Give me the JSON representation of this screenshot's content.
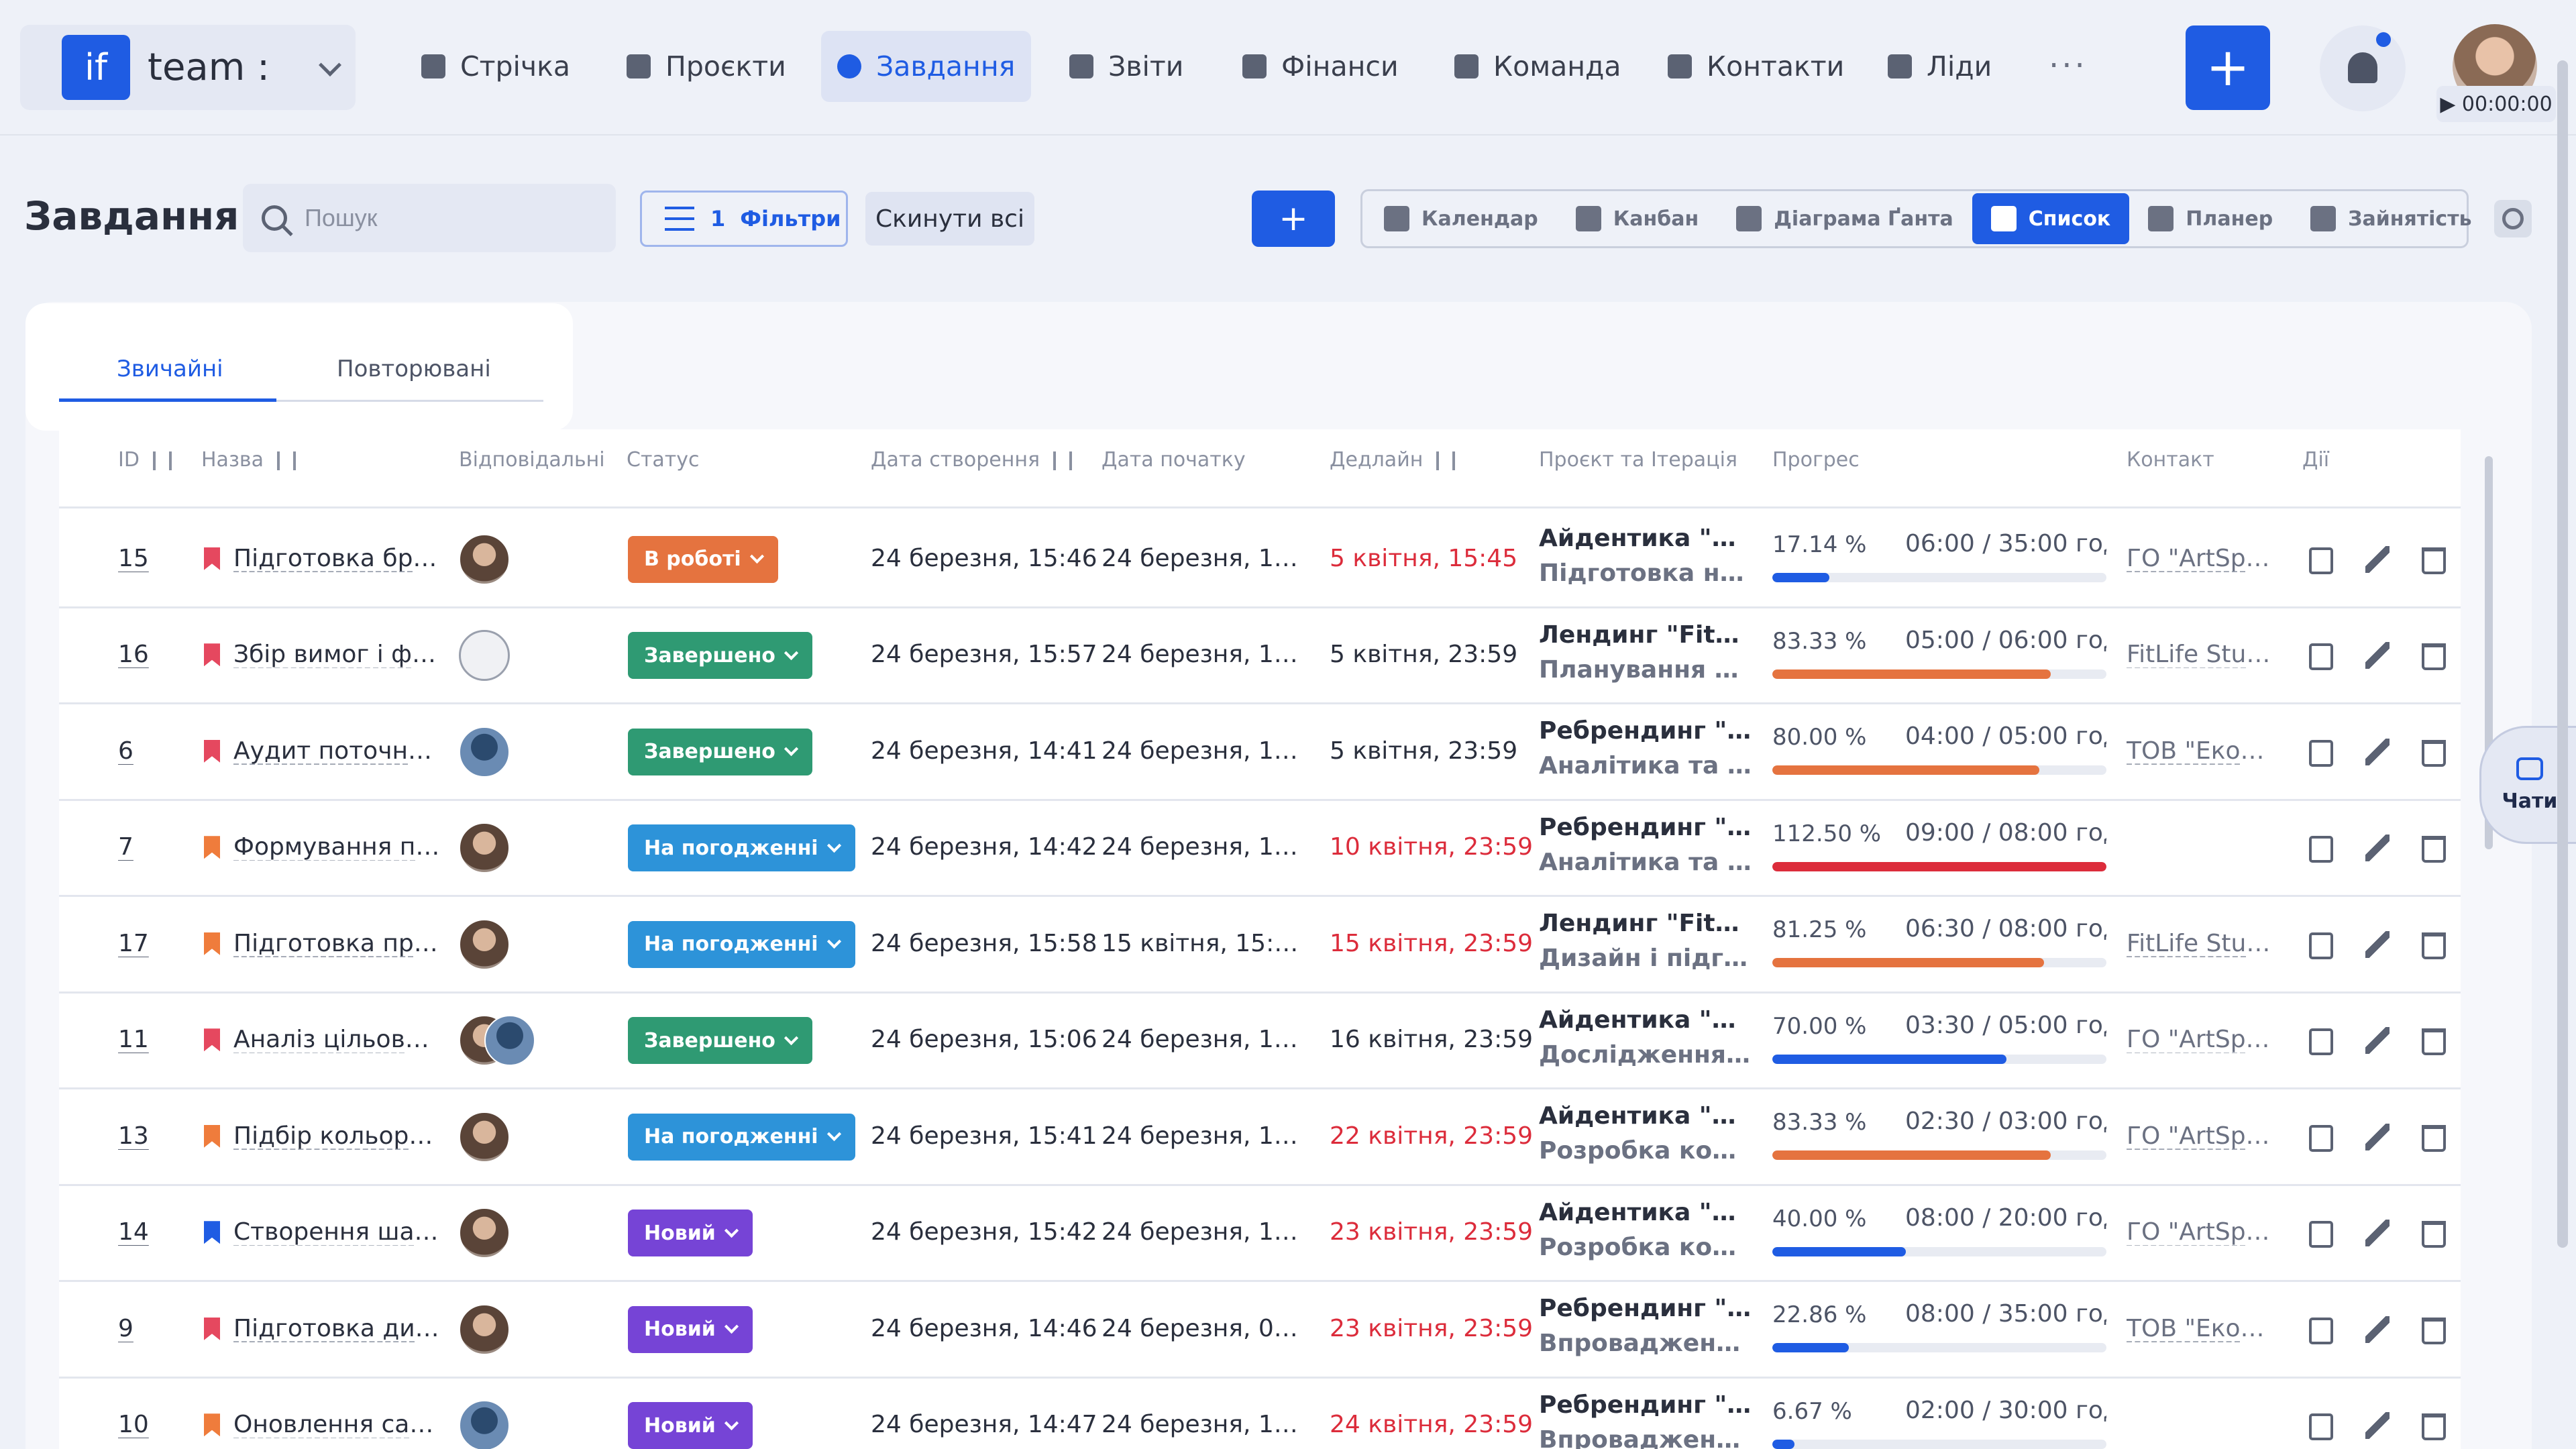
{
  "app": {
    "logo_text": "if",
    "workspace": "team :",
    "timer": "▶ 00:00:00"
  },
  "nav": [
    {
      "label": "Стрічка",
      "icon": "home-icon"
    },
    {
      "label": "Проєкти",
      "icon": "document-icon"
    },
    {
      "label": "Завдання",
      "icon": "check-circle-icon",
      "active": true
    },
    {
      "label": "Звіти",
      "icon": "report-icon"
    },
    {
      "label": "Фінанси",
      "icon": "wallet-icon"
    },
    {
      "label": "Команда",
      "icon": "user-icon"
    },
    {
      "label": "Контакти",
      "icon": "contacts-icon"
    },
    {
      "label": "Ліди",
      "icon": "leads-icon"
    }
  ],
  "more_label": "···",
  "plus_label": "+",
  "page": {
    "title": "Завдання",
    "search_placeholder": "Пошук",
    "filters_count": "1",
    "filters_label": "Фільтри",
    "reset_label": "Скинути всі",
    "add_label": "+"
  },
  "views": [
    {
      "label": "Календар",
      "icon": "calendar-icon"
    },
    {
      "label": "Канбан",
      "icon": "kanban-icon"
    },
    {
      "label": "Діаграма Ґанта",
      "icon": "gantt-icon"
    },
    {
      "label": "Список",
      "icon": "list-icon",
      "active": true
    },
    {
      "label": "Планер",
      "icon": "planner-icon"
    },
    {
      "label": "Зайнятість",
      "icon": "clock-icon"
    }
  ],
  "tabs": {
    "regular": "Звичайні",
    "recurring": "Повторювані"
  },
  "columns": {
    "id": "ID",
    "name": "Назва",
    "assignees": "Відповідальні",
    "status": "Статус",
    "created": "Дата створення",
    "start": "Дата початку",
    "deadline": "Дедлайн",
    "project": "Проєкт та Ітерація",
    "progress": "Прогрес",
    "contact": "Контакт",
    "actions": "Дії"
  },
  "colors": {
    "accent": "#1f5ce3",
    "overdue": "#dc2c3b",
    "flag_red": "#e5485f",
    "flag_orange": "#ef7c3c",
    "flag_blue": "#1f5ce3"
  },
  "status_colors": {
    "В роботі": "#e5733f",
    "Завершено": "#2f9a73",
    "На погодженні": "#2d93d9",
    "Новий": "#7644d6"
  },
  "rows": [
    {
      "id": "15",
      "flag": "#e5485f",
      "name": "Підготовка брен…",
      "assignees": 1,
      "status": "В роботі",
      "created": "24 березня, 15:46",
      "start": "24 березня, 15:45",
      "deadline": "5 квітня, 15:45",
      "overdue": true,
      "project": "Айдентика \"ArtS…",
      "iteration": "Підготовка носії…",
      "pct": "17.14 %",
      "hours": "06:00 / 35:00 год",
      "progress": 0.1714,
      "bar": "#1f5ce3",
      "contact": "ГО \"ArtSpac…"
    },
    {
      "id": "16",
      "flag": "#e5485f",
      "name": "Збір вимог і фор…",
      "assignees": 1,
      "status": "Завершено",
      "created": "24 березня, 15:57",
      "start": "24 березня, 15:56",
      "deadline": "5 квітня, 23:59",
      "overdue": false,
      "project": "Лендинг \"FitLife\"",
      "iteration": "Планування та с…",
      "pct": "83.33 %",
      "hours": "05:00 / 06:00 год",
      "progress": 0.8333,
      "bar": "#e5733f",
      "contact": "FitLife Studio"
    },
    {
      "id": "6",
      "flag": "#e5485f",
      "name": "Аудит поточного…",
      "assignees": 1,
      "status": "Завершено",
      "created": "24 березня, 14:41",
      "start": "24 березня, 14:40",
      "deadline": "5 квітня, 23:59",
      "overdue": false,
      "project": "Ребрендинг \"Еко…",
      "iteration": "Аналітика та бре…",
      "pct": "80.00 %",
      "hours": "04:00 / 05:00 год",
      "progress": 0.8,
      "bar": "#e5733f",
      "contact": "ТОВ \"ЕкоФу…"
    },
    {
      "id": "7",
      "flag": "#ef7c3c",
      "name": "Формування поз…",
      "assignees": 1,
      "status": "На погодженні",
      "created": "24 березня, 14:42",
      "start": "24 березня, 14:42",
      "deadline": "10 квітня, 23:59",
      "overdue": true,
      "project": "Ребрендинг \"Еко…",
      "iteration": "Аналітика та бре…",
      "pct": "112.50 %",
      "hours": "09:00 / 08:00 год",
      "progress": 1.0,
      "bar": "#dc2c3b",
      "contact": ""
    },
    {
      "id": "17",
      "flag": "#ef7c3c",
      "name": "Підготовка прот…",
      "assignees": 1,
      "status": "На погодженні",
      "created": "24 березня, 15:58",
      "start": "15 квітня, 15:57",
      "deadline": "15 квітня, 23:59",
      "overdue": true,
      "project": "Лендинг \"FitLife\"",
      "iteration": "Дизайн і підгото…",
      "pct": "81.25 %",
      "hours": "06:30 / 08:00 год",
      "progress": 0.8125,
      "bar": "#e5733f",
      "contact": "FitLife Studio"
    },
    {
      "id": "11",
      "flag": "#e5485f",
      "name": "Аналіз цільової а…",
      "assignees": 2,
      "status": "Завершено",
      "created": "24 березня, 15:06",
      "start": "24 березня, 15:05",
      "deadline": "16 квітня, 23:59",
      "overdue": false,
      "project": "Айдентика \"ArtS…",
      "iteration": "Дослідження бр…",
      "pct": "70.00 %",
      "hours": "03:30 / 05:00 год",
      "progress": 0.7,
      "bar": "#1f5ce3",
      "contact": "ГО \"ArtSpac…"
    },
    {
      "id": "13",
      "flag": "#ef7c3c",
      "name": "Підбір кольоров…",
      "assignees": 1,
      "status": "На погодженні",
      "created": "24 березня, 15:41",
      "start": "24 березня, 15:40",
      "deadline": "22 квітня, 23:59",
      "overdue": true,
      "project": "Айдентика \"ArtS…",
      "iteration": "Розробка конце…",
      "pct": "83.33 %",
      "hours": "02:30 / 03:00 год",
      "progress": 0.8333,
      "bar": "#e5733f",
      "contact": "ГО \"ArtSpac…"
    },
    {
      "id": "14",
      "flag": "#1f5ce3",
      "name": "Створення шабл…",
      "assignees": 1,
      "status": "Новий",
      "created": "24 березня, 15:42",
      "start": "24 березня, 15:42",
      "deadline": "23 квітня, 23:59",
      "overdue": true,
      "project": "Айдентика \"ArtS…",
      "iteration": "Розробка конце…",
      "pct": "40.00 %",
      "hours": "08:00 / 20:00 год",
      "progress": 0.4,
      "bar": "#1f5ce3",
      "contact": "ГО \"ArtSpac…"
    },
    {
      "id": "9",
      "flag": "#e5485f",
      "name": "Підготовка диза…",
      "assignees": 1,
      "status": "Новий",
      "created": "24 березня, 14:46",
      "start": "24 березня, 08:…",
      "deadline": "23 квітня, 23:59",
      "overdue": true,
      "project": "Ребрендинг \"Еко…",
      "iteration": "Впровадження т…",
      "pct": "22.86 %",
      "hours": "08:00 / 35:00 год",
      "progress": 0.2286,
      "bar": "#1f5ce3",
      "contact": "ТОВ \"ЕкоФу…"
    },
    {
      "id": "10",
      "flag": "#ef7c3c",
      "name": "Оновлення сайт…",
      "assignees": 1,
      "status": "Новий",
      "created": "24 березня, 14:47",
      "start": "24 березня, 14:47",
      "deadline": "24 квітня, 23:59",
      "overdue": true,
      "project": "Ребрендинг \"Еко…",
      "iteration": "Впровадження т…",
      "pct": "6.67 %",
      "hours": "02:00 / 30:00 год",
      "progress": 0.0667,
      "bar": "#1f5ce3",
      "contact": ""
    }
  ],
  "chat_label": "Чати"
}
